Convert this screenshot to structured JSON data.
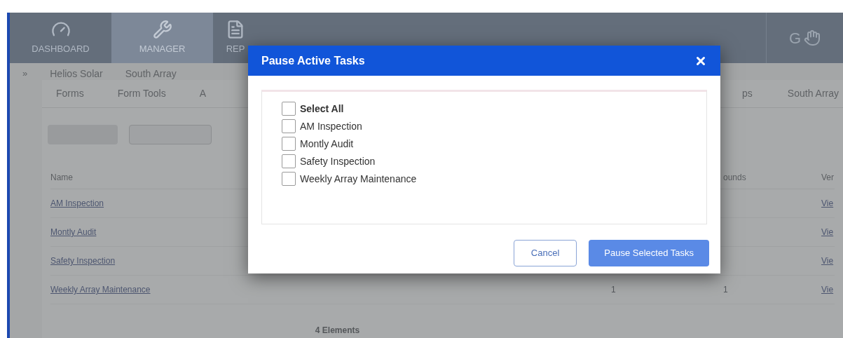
{
  "nav": {
    "items": [
      {
        "label": "DASHBOARD",
        "selected": false
      },
      {
        "label": "MANAGER",
        "selected": true
      },
      {
        "label": "REP",
        "selected": false
      }
    ],
    "logo": "G"
  },
  "breadcrumb": {
    "marker": "»",
    "items": [
      "Helios Solar",
      "South Array"
    ]
  },
  "tabs": {
    "left": [
      "Forms",
      "Form Tools",
      "A"
    ],
    "right": [
      "ps",
      "South Array"
    ]
  },
  "table": {
    "columns": [
      "Name",
      "ounds",
      "Ver"
    ],
    "rows": [
      {
        "name": "AM Inspection",
        "column_2": "",
        "column_3": "",
        "column_4": "Vie"
      },
      {
        "name": "Montly Audit",
        "column_2": "",
        "column_3": "",
        "column_4": "Vie"
      },
      {
        "name": "Safety Inspection",
        "column_2": "",
        "column_3": "",
        "column_4": "Vie"
      },
      {
        "name": "Weekly Array Maintenance",
        "column_2": "1",
        "column_3": "1",
        "column_4": "Vie"
      }
    ],
    "footer": "4 Elements"
  },
  "dialog": {
    "title": "Pause Active Tasks",
    "options": [
      {
        "kind": "all",
        "label": "Select All",
        "checked": false
      },
      {
        "kind": "task",
        "label": "AM Inspection",
        "checked": false
      },
      {
        "kind": "task",
        "label": "Montly Audit",
        "checked": false
      },
      {
        "kind": "task",
        "label": "Safety Inspection",
        "checked": false
      },
      {
        "kind": "task",
        "label": "Weekly Array Maintenance",
        "checked": false
      }
    ],
    "buttons": [
      {
        "kind": "secondary",
        "label": "Cancel"
      },
      {
        "kind": "primary",
        "label": "Pause Selected Tasks"
      }
    ]
  }
}
